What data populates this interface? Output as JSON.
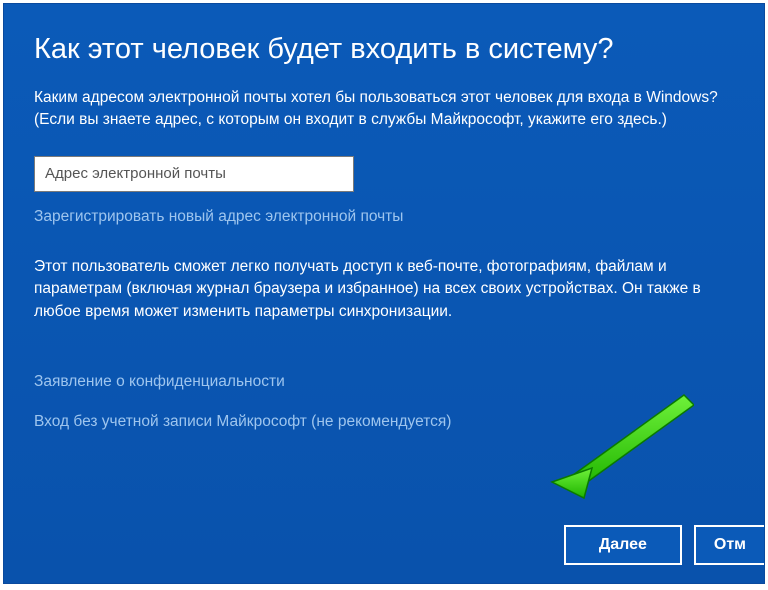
{
  "dialog": {
    "title": "Как этот человек будет входить в систему?",
    "instruction": "Каким адресом электронной почты хотел бы пользоваться этот человек для входа в Windows? (Если вы знаете адрес, с которым он входит в службы Майкрософт, укажите его здесь.)",
    "email_placeholder": "Адрес электронной почты",
    "register_link": "Зарегистрировать новый адрес электронной почты",
    "sync_info": "Этот пользователь сможет легко получать доступ к веб-почте, фотографиям, файлам и параметрам (включая журнал браузера и избранное) на всех своих устройствах. Он также в любое время может изменить параметры синхронизации.",
    "privacy_link": "Заявление о конфиденциальности",
    "no_account_link": "Вход без учетной записи Майкрософт (не рекомендуется)"
  },
  "buttons": {
    "next": "Далее",
    "cancel": "Отм"
  },
  "colors": {
    "background": "#0b5ab8",
    "link": "#9ec5ee",
    "arrow": "#2ecc00"
  }
}
